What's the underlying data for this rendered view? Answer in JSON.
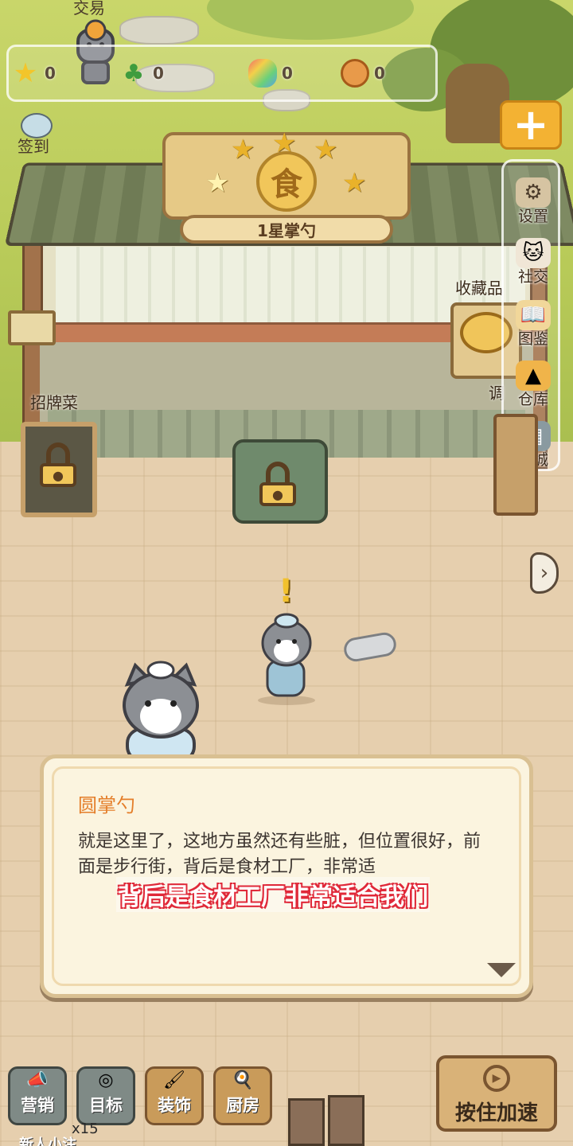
{
  "top": {
    "trade_label": "交易",
    "checkin_label": "签到",
    "currencies": [
      {
        "icon": "star-icon",
        "value": "0"
      },
      {
        "icon": "clover-icon",
        "value": "0"
      },
      {
        "icon": "candy-icon",
        "value": "0"
      },
      {
        "icon": "cookie-icon",
        "value": "0"
      }
    ],
    "plus_symbol": "+"
  },
  "sign": {
    "seal_char": "食",
    "rank_label": "1星掌勺"
  },
  "side_menu": [
    {
      "label": "设置",
      "icon": "gear-icon"
    },
    {
      "label": "社交",
      "icon": "cat-social-icon"
    },
    {
      "label": "图鉴",
      "icon": "book-icon"
    },
    {
      "label": "仓库",
      "icon": "warehouse-icon"
    },
    {
      "label": "商城",
      "icon": "shop-icon"
    }
  ],
  "scene": {
    "signature_dish_label": "招牌菜",
    "collection_label": "收藏品",
    "seasoning_label": "调",
    "exclaim": "!"
  },
  "dialog": {
    "speaker": "圆掌勺",
    "text": "就是这里了，这地方虽然还有些脏，但位置很好，前面是步行街，背后是食材工厂，非常适",
    "subtitle": "背后是食材工厂非常适合我们"
  },
  "bottom": {
    "buttons": [
      {
        "label": "营销",
        "icon": "megaphone-icon"
      },
      {
        "label": "目标",
        "icon": "target-icon"
      },
      {
        "label": "装饰",
        "icon": "paint-roller-icon"
      },
      {
        "label": "厨房",
        "icon": "wok-icon"
      }
    ],
    "speed_label": "按住加速",
    "newbie_count": "x15",
    "newbie_label": "新人小注"
  },
  "colors": {
    "grass": "#b9cb59",
    "floor": "#e6cfae",
    "accent_orange": "#f3b233",
    "speaker_color": "#e47e2a",
    "subtitle_outline": "#e02a3a"
  }
}
